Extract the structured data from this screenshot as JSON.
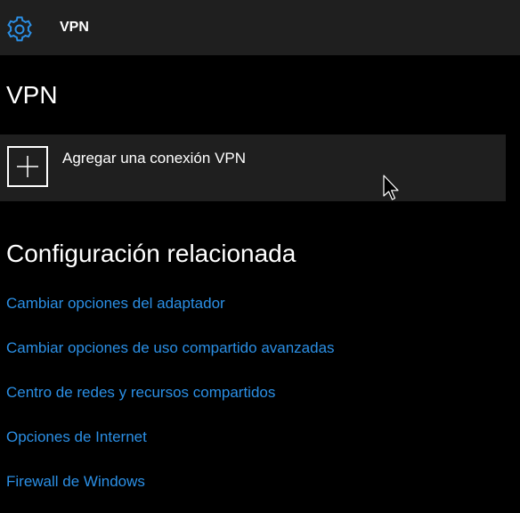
{
  "header": {
    "icon": "gear-icon",
    "title": "VPN"
  },
  "main": {
    "heading": "VPN",
    "add_connection": {
      "icon": "plus-icon",
      "label": "Agregar una conexión VPN"
    }
  },
  "related": {
    "heading": "Configuración relacionada",
    "links": [
      "Cambiar opciones del adaptador",
      "Cambiar opciones de uso compartido avanzadas",
      "Centro de redes y recursos compartidos",
      "Opciones de Internet",
      "Firewall de Windows"
    ]
  },
  "colors": {
    "accent": "#2b8fe5",
    "background": "#000000",
    "panel": "#1f1f1f",
    "text": "#ffffff"
  }
}
